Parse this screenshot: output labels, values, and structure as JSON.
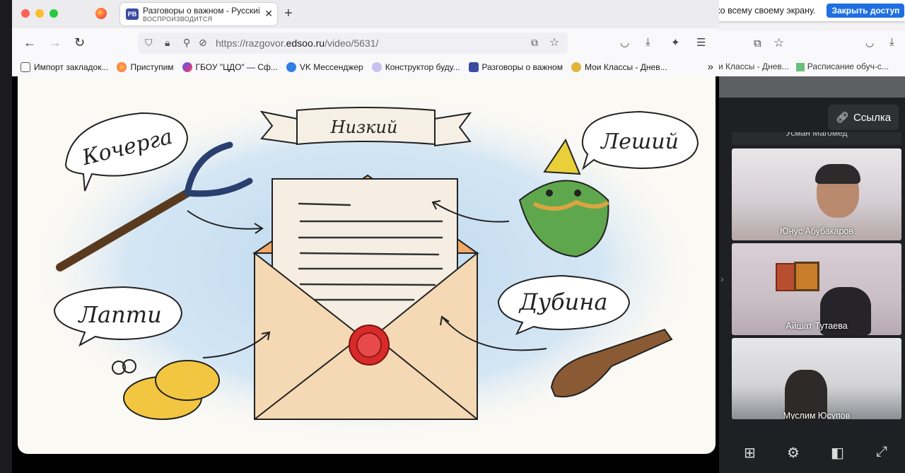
{
  "share_banner": {
    "message": "Вы предоставляете доступ ко всему своему экрану.",
    "stop_label": "Закрыть доступ"
  },
  "tab": {
    "favicon": "PB",
    "title": "Разговоры о важном - Русский",
    "subtitle": "ВОСПРОИЗВОДИТСЯ",
    "close": "✕"
  },
  "toolbar": {
    "url_prefix": "https://razgovor.",
    "url_domain": "edsoo.ru",
    "url_path": "/video/5631/"
  },
  "bookmarks": [
    {
      "label": "Импорт закладок...",
      "icon": "import-icon",
      "color": "#555555"
    },
    {
      "label": "Приступим",
      "icon": "firefox-icon",
      "color": "#ff7139"
    },
    {
      "label": "ГБОУ \"ЦДО\" — Сф...",
      "icon": "globe-icon",
      "color": "#6b3fd8"
    },
    {
      "label": "VK Мессенджер",
      "icon": "vk-icon",
      "color": "#2f7fe6"
    },
    {
      "label": "Конструктор буду...",
      "icon": "eyes-icon",
      "color": "#8a7bd8"
    },
    {
      "label": "Разговоры о важном",
      "icon": "pb-icon",
      "color": "#3b4ba0"
    },
    {
      "label": "Мои Классы - Днев...",
      "icon": "class-icon",
      "color": "#e1b43a"
    }
  ],
  "bg_bookmarks": [
    {
      "label": "и Классы - Днев..."
    },
    {
      "label": "Расписание обуч-с..."
    }
  ],
  "slide": {
    "banner_word": "Низкий",
    "labels": {
      "top_left": "Кочерга",
      "top_right": "Леший",
      "bottom_left": "Лапти",
      "bottom_right": "Дубина"
    }
  },
  "call": {
    "share_link_label": "Ссылка",
    "partial_top_name": "Усман Магомед",
    "participants": [
      {
        "name": "Юнус Абубакаров"
      },
      {
        "name": "Айшат Тутаева"
      },
      {
        "name": "Муслим Юсупов"
      }
    ]
  }
}
